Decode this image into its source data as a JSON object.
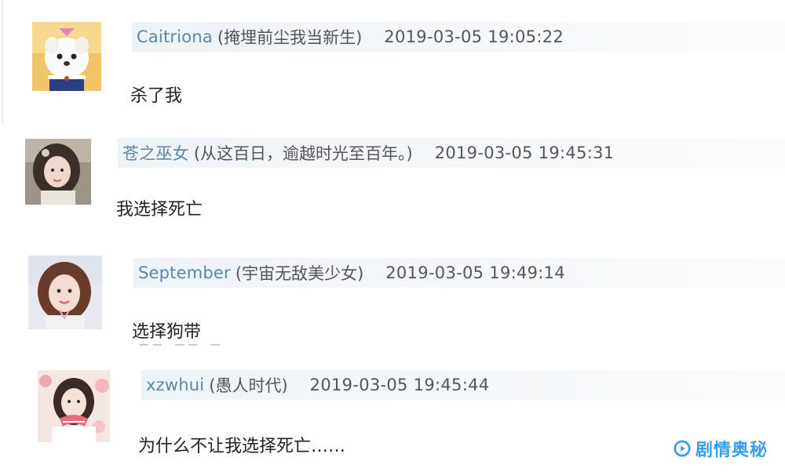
{
  "comments": [
    {
      "username": "Caitriona",
      "nickname": "(掩埋前尘我当新生)",
      "timestamp": "2019-03-05 19:05:22",
      "message": "杀了我",
      "avatar_icon": "white-puppy-avatar-icon"
    },
    {
      "username": "苍之巫女",
      "nickname": "(从这百日，逾越时光至百年。)",
      "timestamp": "2019-03-05 19:45:31",
      "message": "我选择死亡",
      "avatar_icon": "girl-portrait-avatar-icon"
    },
    {
      "username": "September",
      "nickname": "(宇宙无敌美少女)",
      "timestamp": "2019-03-05 19:49:14",
      "message": "选择狗带",
      "avatar_icon": "girl-portrait-avatar-icon"
    },
    {
      "username": "xzwhui",
      "nickname": "(愚人时代)",
      "timestamp": "2019-03-05 19:45:44",
      "message": "为什么不让我选择死亡……",
      "avatar_icon": "girl-with-flowers-avatar-icon"
    }
  ],
  "watermark": {
    "label": "剧情奥秘",
    "icon": "play-circle-icon",
    "color": "#3b9ee8"
  },
  "colors": {
    "username": "#5a86a8",
    "meta_text": "#555555",
    "message_text": "#222222",
    "header_bg": "#eef3f7"
  }
}
